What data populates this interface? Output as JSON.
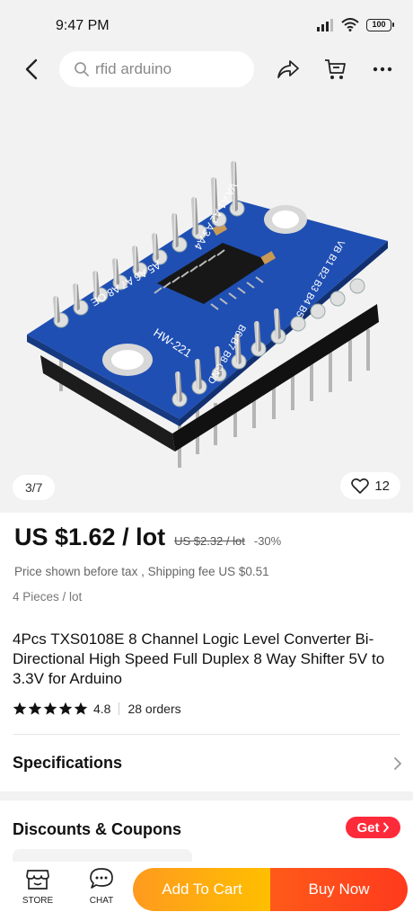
{
  "status_bar": {
    "time": "9:47 PM",
    "battery": "100"
  },
  "header": {
    "search_value": "rfid arduino"
  },
  "gallery": {
    "counter": "3/7",
    "likes": "12",
    "chip_label": "HW-221",
    "pin_labels_top": "VA A1 A2 A3 A4",
    "pin_labels_side": "A5 A6 A7 A8 OE",
    "pin_labels_right": "VB B1 B2 B3 B4 B5",
    "pin_labels_bottom": "B6 B7 B8 GND"
  },
  "price": {
    "current": "US $1.62 / lot",
    "original": "US $2.32 / lot",
    "discount": "-30%",
    "tax_note": "Price shown before tax , Shipping fee US $0.51",
    "pieces": "4 Pieces / lot"
  },
  "product": {
    "title": "4Pcs TXS0108E 8 Channel Logic Level Converter Bi-Directional High Speed Full Duplex 8 Way Shifter 5V to 3.3V for Arduino",
    "rating": "4.8",
    "orders": "28 orders",
    "stars": 5
  },
  "sections": {
    "specifications": "Specifications",
    "discounts": "Discounts & Coupons",
    "get_label": "Get"
  },
  "bottom_bar": {
    "store": "STORE",
    "chat": "CHAT",
    "add_to_cart": "Add To Cart",
    "buy_now": "Buy Now"
  },
  "colors": {
    "board": "#1f4fb3",
    "cart_gradient_start": "#ff9a1f",
    "buy_gradient_start": "#ff5a1a",
    "get_button": "#fd2a3a"
  }
}
